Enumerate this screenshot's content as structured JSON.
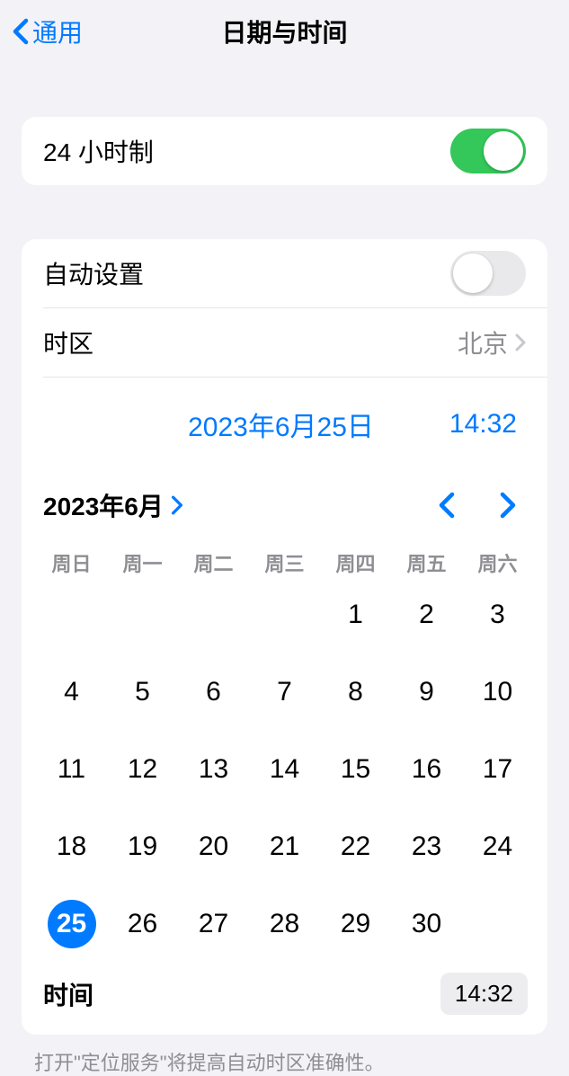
{
  "header": {
    "back_label": "通用",
    "title": "日期与时间"
  },
  "settings": {
    "hour24_label": "24 小时制",
    "auto_set_label": "自动设置",
    "timezone_label": "时区",
    "timezone_value": "北京"
  },
  "date_time": {
    "date_display": "2023年6月25日",
    "time_display": "14:32"
  },
  "calendar": {
    "month_label": "2023年6月",
    "weekdays": [
      "周日",
      "周一",
      "周二",
      "周三",
      "周四",
      "周五",
      "周六"
    ],
    "leading_blank": 4,
    "days_in_month": 30,
    "selected_day": 25
  },
  "time_row": {
    "label": "时间",
    "value": "14:32"
  },
  "footer": {
    "text": "打开\"定位服务\"将提高自动时区准确性。"
  }
}
